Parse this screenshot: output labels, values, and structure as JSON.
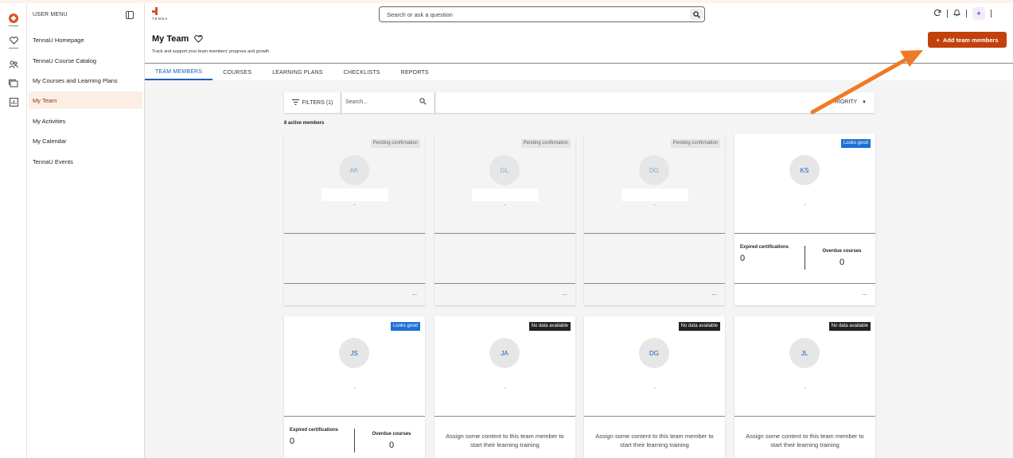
{
  "app": {
    "brand": "TENNA"
  },
  "menu": {
    "header": "USER MENU",
    "items": [
      {
        "label": "TennaU Homepage"
      },
      {
        "label": "TennaU Course Catalog"
      },
      {
        "label": "My Courses and Learning Plans"
      },
      {
        "label": "My Team"
      },
      {
        "label": "My Activities"
      },
      {
        "label": "My Calendar"
      },
      {
        "label": "TennaU Events"
      }
    ],
    "active": "My Team"
  },
  "header": {
    "search_placeholder": "Search or ask a question"
  },
  "page": {
    "title": "My Team",
    "subtitle": "Track and support your team members' progress and growth",
    "add_button": "Add team members"
  },
  "tabs": [
    "TEAM MEMBERS",
    "COURSES",
    "LEARNING PLANS",
    "CHECKLISTS",
    "REPORTS"
  ],
  "toolbar": {
    "filters_label": "FILTERS (1)",
    "search_placeholder": "Search...",
    "sort_label": "RIORITY"
  },
  "members_count": "8 active members",
  "cards": [
    {
      "initials": "AK",
      "status": "Pending confirmation",
      "sub": "-",
      "dots": "..."
    },
    {
      "initials": "GL",
      "status": "Pending confirmation",
      "sub": "-",
      "dots": "..."
    },
    {
      "initials": "DG",
      "status": "Pending confirmation",
      "sub": "-",
      "dots": "..."
    },
    {
      "initials": "KS",
      "status": "Looks good",
      "sub": "-",
      "expired_label": "Expired certifications",
      "expired_value": "0",
      "overdue_label": "Overdue courses",
      "overdue_value": "0",
      "dots": "..."
    },
    {
      "initials": "JS",
      "status": "Looks good",
      "sub": "-",
      "expired_label": "Expired certifications",
      "expired_value": "0",
      "overdue_label": "Overdue courses",
      "overdue_value": "0"
    },
    {
      "initials": "JA",
      "status": "No data available",
      "sub": "-",
      "message": "Assign some content to this team member to start their learning training"
    },
    {
      "initials": "DG",
      "status": "No data available",
      "sub": "-",
      "message": "Assign some content to this team member to start their learning training"
    },
    {
      "initials": "JL",
      "status": "No data available",
      "sub": "-",
      "message": "Assign some content to this team member to start their learning training"
    }
  ],
  "colors": {
    "brand": "#c2410c",
    "accent_blue": "#1a5fb4",
    "active_menu_bg": "#fdeee5",
    "annotation_arrow": "#f07a24"
  }
}
